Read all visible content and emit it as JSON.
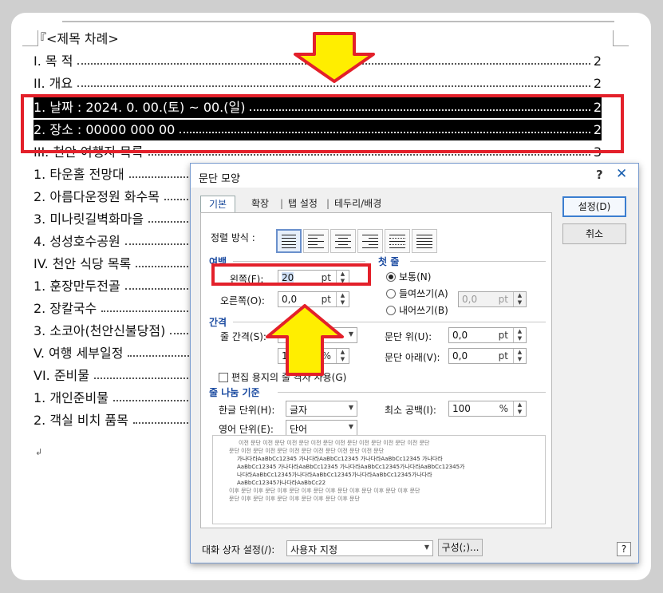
{
  "document": {
    "lines": [
      {
        "text": "『<제목 차례>",
        "page": ""
      },
      {
        "text": "I. 목 적",
        "page": "2"
      },
      {
        "text": "II. 개요",
        "page": "2"
      },
      {
        "text": "1. 날짜 : 2024. 0. 00.(토) ~ 00.(일)",
        "page": "2",
        "selected": true
      },
      {
        "text": "2. 장소 : 00000 000 00",
        "page": "2",
        "selected": true
      },
      {
        "text": "III. 천안 여행지 목록",
        "page": "3"
      },
      {
        "text": "1. 타운홀 전망대",
        "page": ""
      },
      {
        "text": "2. 아름다운정원 화수목",
        "page": ""
      },
      {
        "text": "3. 미나릿길벽화마을",
        "page": ""
      },
      {
        "text": "4. 성성호수공원",
        "page": ""
      },
      {
        "text": "IV. 천안 식당 목록",
        "page": ""
      },
      {
        "text": "1. 훈장만두전골",
        "page": ""
      },
      {
        "text": "2. 장칼국수",
        "page": ""
      },
      {
        "text": "3. 소코아(천안신불당점)",
        "page": ""
      },
      {
        "text": "V. 여행 세부일정",
        "page": ""
      },
      {
        "text": "VI. 준비물",
        "page": ""
      },
      {
        "text": "1. 개인준비물",
        "page": ""
      },
      {
        "text": "2. 객실 비치 품목",
        "page": ""
      }
    ],
    "paragraph_mark": "↲"
  },
  "dialog": {
    "title": "문단 모양",
    "help": "?",
    "close": "✕",
    "tabs": [
      "기본",
      "확장",
      "탭 설정",
      "테두리/배경"
    ],
    "align_label": "정렬 방식 :",
    "margin_section": "여백",
    "left_label": "왼쪽(F):",
    "left_value": "20",
    "right_label": "오른쪽(O):",
    "right_value": "0,0",
    "unit": "pt",
    "first_line_section": "첫 줄",
    "first_line_options": [
      "보통(N)",
      "들여쓰기(A)",
      "내어쓰기(B)"
    ],
    "first_line_value": "0,0",
    "spacing_section": "간격",
    "line_spacing_label": "줄 간격(S):",
    "line_spacing_value": "1",
    "line_spacing_unit": "%",
    "above_label": "문단 위(U):",
    "above_value": "0,0",
    "below_label": "문단 아래(V):",
    "below_value": "0,0",
    "grid_checkbox": "편집 용지의 줄 격자 사용(G)",
    "break_section": "줄 나눔 기준",
    "korean_unit_label": "한글 단위(H):",
    "korean_unit_value": "글자",
    "english_unit_label": "영어 단위(E):",
    "english_unit_value": "단어",
    "min_space_label": "최소 공백(I):",
    "min_space_value": "100",
    "min_space_unit": "%",
    "preview_lines": [
      "이전 문단 이전 문단 이전 문단 이전 문단 이전 문단 이전 문단 이전 문단 이전 문단",
      "문단 이전 문단 이전 문단 이전 문단 이전 문단 이전 문단 이전 문단",
      "가나다라AaBbCc12345  가나다라AaBbCc12345  가나다라AaBbCc12345  가나다라",
      "AaBbCc12345 가나다라AaBbCc12345 가나다라AaBbCc12345가나다라AaBbCc12345가",
      "나다라AaBbCc12345가나다라AaBbCc12345가나다라AaBbCc12345가나다라",
      "AaBbCc12345가나다라AaBbCc22",
      "이후 문단 이후 문단 이후 문단 이후 문단 이후 문단 이후 문단 이후 문단 이후 문단",
      "문단 이후 문단 이후 문단 이후 문단 이후 문단 이후 문단"
    ],
    "ok_button": "설정(D)",
    "cancel_button": "취소",
    "dialog_setting_label": "대화 상자 설정(/):",
    "dialog_setting_value": "사용자 지정",
    "config_button": "구성(;)...",
    "bottom_help": "?"
  },
  "colors": {
    "highlight_red": "#e3202a",
    "arrow_yellow": "#ffee00",
    "selection": "#000000",
    "accent_blue": "#1a4aa0"
  }
}
